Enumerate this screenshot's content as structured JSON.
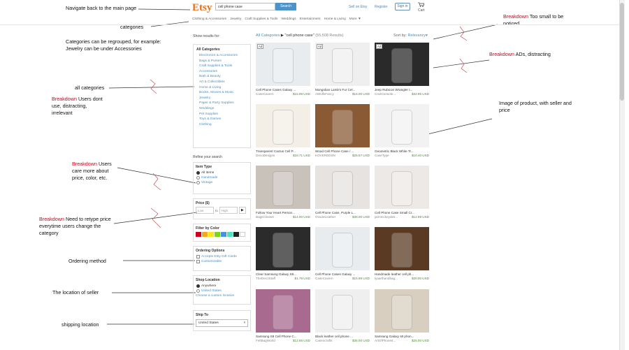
{
  "annotations": {
    "navigate_back": "Navigate back to the main page",
    "categories": "categories",
    "regroup": "Categories can be regrouped, for example: Jewelry can be under Accessories",
    "all_categories": "all categories",
    "breakdown_label": "Breakdown",
    "users_dont_use": "Users dont use, distracting, irrelevant",
    "care_more": "Users care more about price, color, etc.",
    "retype": "Need to retype price everytime users change the category",
    "ordering": "Ordering method",
    "location_seller": "The location of seller",
    "shipping_location": "shipping location",
    "too_small": "Too small to be noticed",
    "ads": "ADs, distracting",
    "image_product": "Image of product, with seller and price"
  },
  "header": {
    "logo": "Etsy",
    "search_value": "cell phone case",
    "search_button": "Search",
    "sell": "Sell on Etsy",
    "register": "Register",
    "signin": "Sign in",
    "cart": "Cart",
    "nav": [
      "Clothing & Accessories",
      "Jewelry",
      "Craft Supplies & Tools",
      "Weddings",
      "Entertainment",
      "Home & Living",
      "More ▼"
    ]
  },
  "sidebar": {
    "show_results": "Show results for:",
    "all_categories": "All Categories",
    "categories": [
      "Electronics & Accessories",
      "Bags & Purses",
      "Craft Supplies & Tools",
      "Accessories",
      "Bath & Beauty",
      "Art & Collectibles",
      "Home & Living",
      "Books, Movies & Music",
      "Jewelry",
      "Paper & Party Supplies",
      "Weddings",
      "Pet Supplies",
      "Toys & Games",
      "Clothing"
    ],
    "refine": "Refine your search",
    "item_type": "Item Type",
    "item_types": [
      "All items",
      "Handmade",
      "Vintage"
    ],
    "price": "Price ($)",
    "low": "Low",
    "to": "to",
    "high": "High",
    "filter_color": "Filter by Color",
    "colors": [
      "#d0021b",
      "#f5a623",
      "#f8e71c",
      "#7ed321",
      "#4a90e2",
      "#50e3c2",
      "#222222",
      "#ffffff"
    ],
    "ordering_options": "Ordering Options",
    "ordering": [
      "Accepts Etsy Gift Cards",
      "Customizable"
    ],
    "shop_location": "Shop Location",
    "locations": [
      "Anywhere",
      "United States"
    ],
    "custom_location": "Choose a custom location",
    "ship_to": "Ship To",
    "ship_value": "United States"
  },
  "results": {
    "breadcrumb_cat": "All Categories",
    "breadcrumb_query": "\"cell phone case\"",
    "count": "(55,508 Results)",
    "sort_label": "Sort by:",
    "sort_value": "Relevancy",
    "ad_label": "Ad",
    "products": [
      {
        "title": "Cell Phone Cases Galaxy ...",
        "shop": "CaseCavern",
        "price": "$15.99 USD",
        "ad": true,
        "color": "#e9ecef"
      },
      {
        "title": "Mongolian Lamb's Fur Cel...",
        "shop": "AWolfsFancy",
        "price": "$15.00 USD",
        "ad": true,
        "color": "#efefef"
      },
      {
        "title": "Jeep Rubicon Wrangler I...",
        "shop": "CoolConsole...",
        "price": "$32.95 USD",
        "ad": true,
        "color": "#2a2a2a"
      },
      {
        "title": "Transparent Cactus Cell P...",
        "shop": "DecoDesigns",
        "price": "$18.71 USD",
        "ad": false,
        "color": "#f3efe6"
      },
      {
        "title": "Wood Cell Phone Case / ...",
        "shop": "KOVEREDSN",
        "price": "$25.57 USD",
        "ad": false,
        "color": "#8a5a35"
      },
      {
        "title": "Geometric Black White Tr...",
        "shop": "CaseType",
        "price": "$10.40 USD",
        "ad": false,
        "color": "#f2f2f2"
      },
      {
        "title": "Follow Your Heart Person...",
        "shop": "BagsClosset",
        "price": "$14.00 USD",
        "ad": false,
        "color": "#c9c2bb"
      },
      {
        "title": "Cell Phone Case, Purple L...",
        "shop": "OracleLeather",
        "price": "$38.00 USD",
        "ad": false,
        "color": "#e6e3e1"
      },
      {
        "title": "Cell Phone Case Small Cr...",
        "shop": "jarinmckeydes...",
        "price": "$12.99 USD",
        "ad": false,
        "color": "#ece9e6"
      },
      {
        "title": "Clear Samsung Galaxy S8...",
        "shop": "TheDecoStaff",
        "price": "$1.78 USD",
        "ad": false,
        "color": "#2b2b2b"
      },
      {
        "title": "Cell Phone Cases Galaxy ...",
        "shop": "CaseCavern",
        "price": "$15.99 USD",
        "ad": false,
        "color": "#e9ecef"
      },
      {
        "title": "Handmade leather cell ph...",
        "shop": "lyaarthandbag...",
        "price": "$30.00 USD",
        "ad": false,
        "color": "#5a3a22"
      },
      {
        "title": "Samsung S8 Cell Phone C...",
        "shop": "FeltBagWorld",
        "price": "$12.66 USD",
        "ad": false,
        "color": "#a86a8f"
      },
      {
        "title": "Black leather cell phone ...",
        "shop": "Caseocrafts",
        "price": "$35.00 USD",
        "ad": false,
        "color": "#efefef"
      },
      {
        "title": "Samsung Galaxy s8 phon...",
        "shop": "ArtOfPhones...",
        "price": "$25.00 USD",
        "ad": false,
        "color": "#d8cfc0"
      }
    ]
  }
}
